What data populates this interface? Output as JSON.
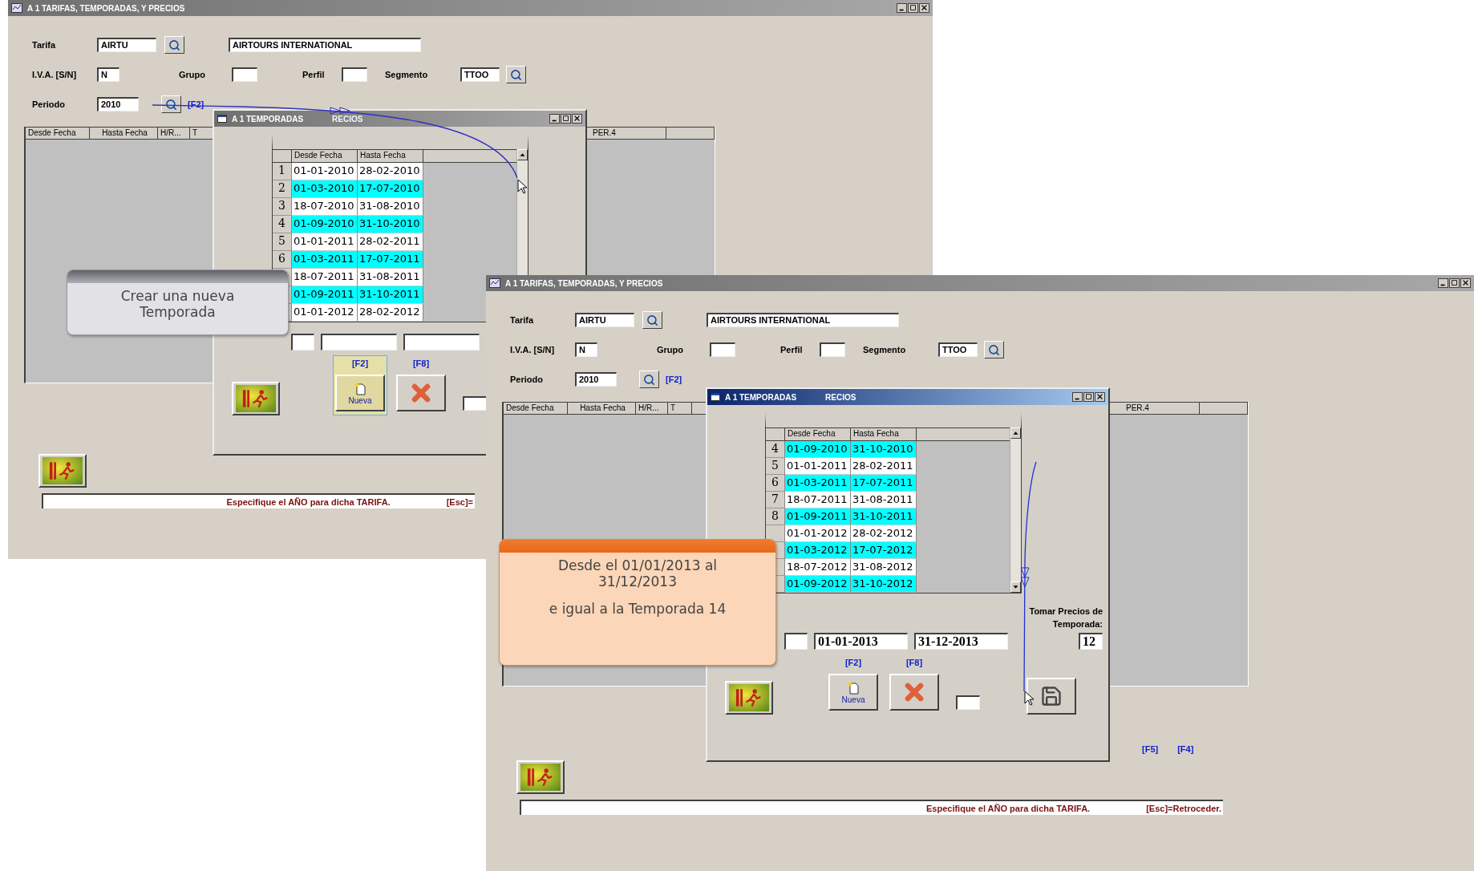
{
  "screens": [
    {
      "title": "A 1  TARIFAS, TEMPORADAS, Y PRECIOS",
      "form": {
        "tarifa_label": "Tarifa",
        "tarifa_code": "AIRTU",
        "tarifa_name": "AIRTOURS INTERNATIONAL",
        "iva_label": "I.V.A. [S/N]",
        "iva_value": "N",
        "grupo_label": "Grupo",
        "perfil_label": "Perfil",
        "segmento_label": "Segmento",
        "segmento_value": "TTOO",
        "periodo_label": "Periodo",
        "periodo_value": "2010",
        "periodo_key": "[F2]"
      },
      "grid": {
        "columns": [
          "Desde Fecha",
          "Hasta Fecha",
          "H/R...",
          "T"
        ],
        "right_columns": [
          "PER.4"
        ]
      },
      "dialog": {
        "title": "A 1 TEMPORADAS",
        "title_trail": "RECIOS",
        "active": false,
        "columns": [
          "Desde Fecha",
          "Hasta Fecha"
        ],
        "rows": [
          {
            "number": "1",
            "from": "01-01-2010",
            "to": "28-02-2010",
            "highlighted": false
          },
          {
            "number": "2",
            "from": "01-03-2010",
            "to": "17-07-2010",
            "highlighted": true
          },
          {
            "number": "3",
            "from": "18-07-2010",
            "to": "31-08-2010",
            "highlighted": false
          },
          {
            "number": "4",
            "from": "01-09-2010",
            "to": "31-10-2010",
            "highlighted": true
          },
          {
            "number": "5",
            "from": "01-01-2011",
            "to": "28-02-2011",
            "highlighted": false
          },
          {
            "number": "6",
            "from": "01-03-2011",
            "to": "17-07-2011",
            "highlighted": true
          },
          {
            "from": "18-07-2011",
            "to": "31-08-2011",
            "highlighted": false
          },
          {
            "from": "01-09-2011",
            "to": "31-10-2011",
            "highlighted": true
          },
          {
            "from": "01-01-2012",
            "to": "28-02-2012",
            "highlighted": false
          }
        ],
        "new_key": "[F2]",
        "delete_key": "[F8]",
        "new_label": "Nueva",
        "new_focused": true
      },
      "callout": {
        "kind": "gray",
        "paragraphs": [
          [
            "Crear una nueva",
            "Temporada"
          ]
        ]
      },
      "status": {
        "message": "Especifique el AÑO para dicha TARIFA.",
        "escape": "[Esc]="
      }
    },
    {
      "title": "A 1  TARIFAS, TEMPORADAS, Y PRECIOS",
      "form": {
        "tarifa_label": "Tarifa",
        "tarifa_code": "AIRTU",
        "tarifa_name": "AIRTOURS INTERNATIONAL",
        "iva_label": "I.V.A. [S/N]",
        "iva_value": "N",
        "grupo_label": "Grupo",
        "perfil_label": "Perfil",
        "segmento_label": "Segmento",
        "segmento_value": "TTOO",
        "periodo_label": "Periodo",
        "periodo_value": "2010",
        "periodo_key": "[F2]"
      },
      "grid": {
        "columns": [
          "Desde Fecha",
          "Hasta Fecha",
          "H/R...",
          "T"
        ],
        "right_columns": [
          "PER.4"
        ]
      },
      "dialog": {
        "title": "A 1 TEMPORADAS",
        "title_trail": "RECIOS",
        "active": true,
        "columns": [
          "Desde Fecha",
          "Hasta Fecha"
        ],
        "rows": [
          {
            "number": "4",
            "from": "01-09-2010",
            "to": "31-10-2010",
            "highlighted": true
          },
          {
            "number": "5",
            "from": "01-01-2011",
            "to": "28-02-2011",
            "highlighted": false
          },
          {
            "number": "6",
            "from": "01-03-2011",
            "to": "17-07-2011",
            "highlighted": true
          },
          {
            "number": "7",
            "from": "18-07-2011",
            "to": "31-08-2011",
            "highlighted": false
          },
          {
            "number": "8",
            "from": "01-09-2011",
            "to": "31-10-2011",
            "highlighted": true
          },
          {
            "from": "01-01-2012",
            "to": "28-02-2012",
            "highlighted": false
          },
          {
            "from": "01-03-2012",
            "to": "17-07-2012",
            "highlighted": true
          },
          {
            "from": "18-07-2012",
            "to": "31-08-2012",
            "highlighted": false
          },
          {
            "from": "01-09-2012",
            "to": "31-10-2012",
            "highlighted": true
          }
        ],
        "new_period": {
          "from": "01-01-2013",
          "to": "31-12-2013"
        },
        "take_prices": {
          "label": "Tomar Precios de Temporada:",
          "value": "12"
        },
        "new_key": "[F2]",
        "delete_key": "[F8]",
        "new_label": "Nueva",
        "new_focused": false,
        "save_button": true
      },
      "callout": {
        "kind": "orange",
        "paragraphs": [
          [
            "Desde el 01/01/2013 al",
            "31/12/2013"
          ],
          [
            "e igual a la Temporada 14"
          ]
        ]
      },
      "function_keys": [
        "[F5]",
        "[F4]"
      ],
      "status": {
        "message": "Especifique el AÑO para dicha TARIFA.",
        "escape": "[Esc]=Retroceder."
      }
    }
  ]
}
